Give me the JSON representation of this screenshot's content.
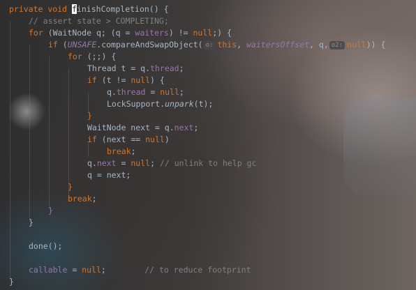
{
  "colors": {
    "keyword": "#cc7832",
    "comment": "#808080",
    "field": "#9876aa",
    "text": "#a9b7c6"
  },
  "code": {
    "l1": {
      "kw": "private void ",
      "caret_char": "f",
      "rest": "inishCompletion() {"
    },
    "l2": {
      "comment": "// assert state > COMPLETING;"
    },
    "l3": {
      "kw_for": "for",
      "p1": " (WaitNode ",
      "v": "q",
      "p2": "; (",
      "v2": "q",
      "p3": " = ",
      "f": "waiters",
      "p4": ") != ",
      "null": "null",
      "p5": ";) {"
    },
    "l4": {
      "kw_if": "if",
      "p1": " (",
      "cls": "UNSAFE",
      "p2": ".compareAndSwapObject(",
      "hint1": "o:",
      "this": "this",
      "p3": ", ",
      "f": "waitersOffset",
      "p4": ", ",
      "v": "q",
      "p5": ",",
      "hint2": "o2:",
      "null": "null",
      "p6": ")) {"
    },
    "l5": {
      "kw_for": "for",
      "p1": " (;;) {"
    },
    "l6": {
      "p1": "Thread t = ",
      "v": "q",
      "p2": ".",
      "f": "thread",
      "p3": ";"
    },
    "l7": {
      "kw_if": "if",
      "p1": " (t != ",
      "null": "null",
      "p2": ") {"
    },
    "l8": {
      "v": "q",
      "p1": ".",
      "f": "thread",
      "p2": " = ",
      "null": "null",
      "p3": ";"
    },
    "l9": {
      "p1": "LockSupport.",
      "m": "unpark",
      "p2": "(t);"
    },
    "l10": {
      "p1": "}"
    },
    "l11": {
      "p1": "WaitNode next = ",
      "v": "q",
      "p2": ".",
      "f": "next",
      "p3": ";"
    },
    "l12": {
      "kw_if": "if",
      "p1": " (next == ",
      "null": "null",
      "p2": ")"
    },
    "l13": {
      "kw_break": "break",
      "p1": ";"
    },
    "l14": {
      "v": "q",
      "p1": ".",
      "f": "next",
      "p2": " = ",
      "null": "null",
      "p3": "; ",
      "comment": "// unlink to help gc"
    },
    "l15": {
      "v": "q",
      "p1": " = next;"
    },
    "l16": {
      "p1": "}"
    },
    "l17": {
      "kw_break": "break",
      "p1": ";"
    },
    "l18": {
      "p1": "}"
    },
    "l19": {
      "p1": "}"
    },
    "l20": {
      "p1": "done();"
    },
    "l21": {
      "f": "callable",
      "p1": " = ",
      "null": "null",
      "p2": ";        ",
      "comment": "// to reduce footprint"
    },
    "l22": {
      "p1": "}"
    }
  }
}
